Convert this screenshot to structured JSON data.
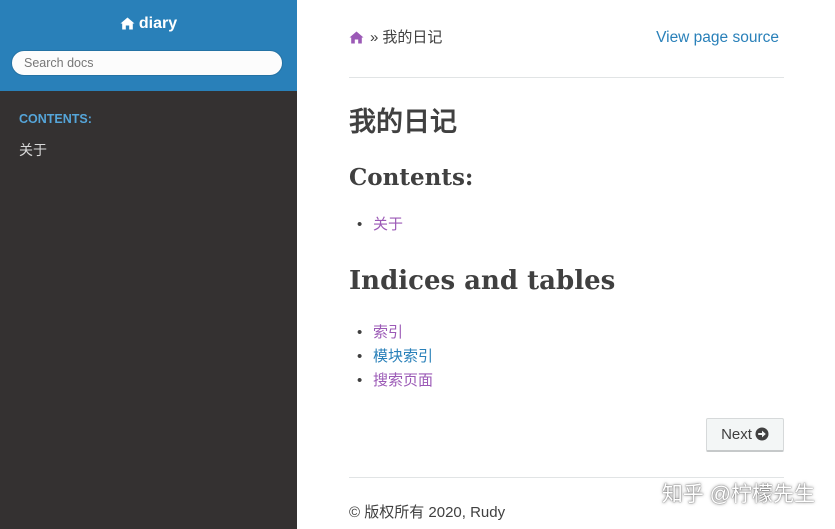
{
  "colors": {
    "sidebar_top": "#2980b9",
    "sidebar_bg": "#343131",
    "link": "#2980b9",
    "visited_link": "#9b59b6",
    "caption": "#55a5d9",
    "text": "#404040"
  },
  "sidebar": {
    "brand_icon": "home-icon",
    "brand": "diary",
    "search_placeholder": "Search docs",
    "caption": "CONTENTS:",
    "items": [
      {
        "label": "关于"
      }
    ]
  },
  "breadcrumbs": {
    "home_icon": "home-icon",
    "separator": "»",
    "current": "我的日记",
    "view_source": "View page source"
  },
  "main": {
    "title": "我的日记",
    "contents_heading": "Contents:",
    "contents_links": [
      {
        "label": "关于"
      }
    ],
    "indices_heading": "Indices and tables",
    "indices_links": [
      {
        "label": "索引"
      },
      {
        "label": "模块索引"
      },
      {
        "label": "搜索页面"
      }
    ]
  },
  "footer": {
    "next_label": "Next",
    "next_icon": "arrow-circle-right-icon",
    "copyright": "© 版权所有 2020, Rudy",
    "watermark": "知乎 @柠檬先生"
  }
}
